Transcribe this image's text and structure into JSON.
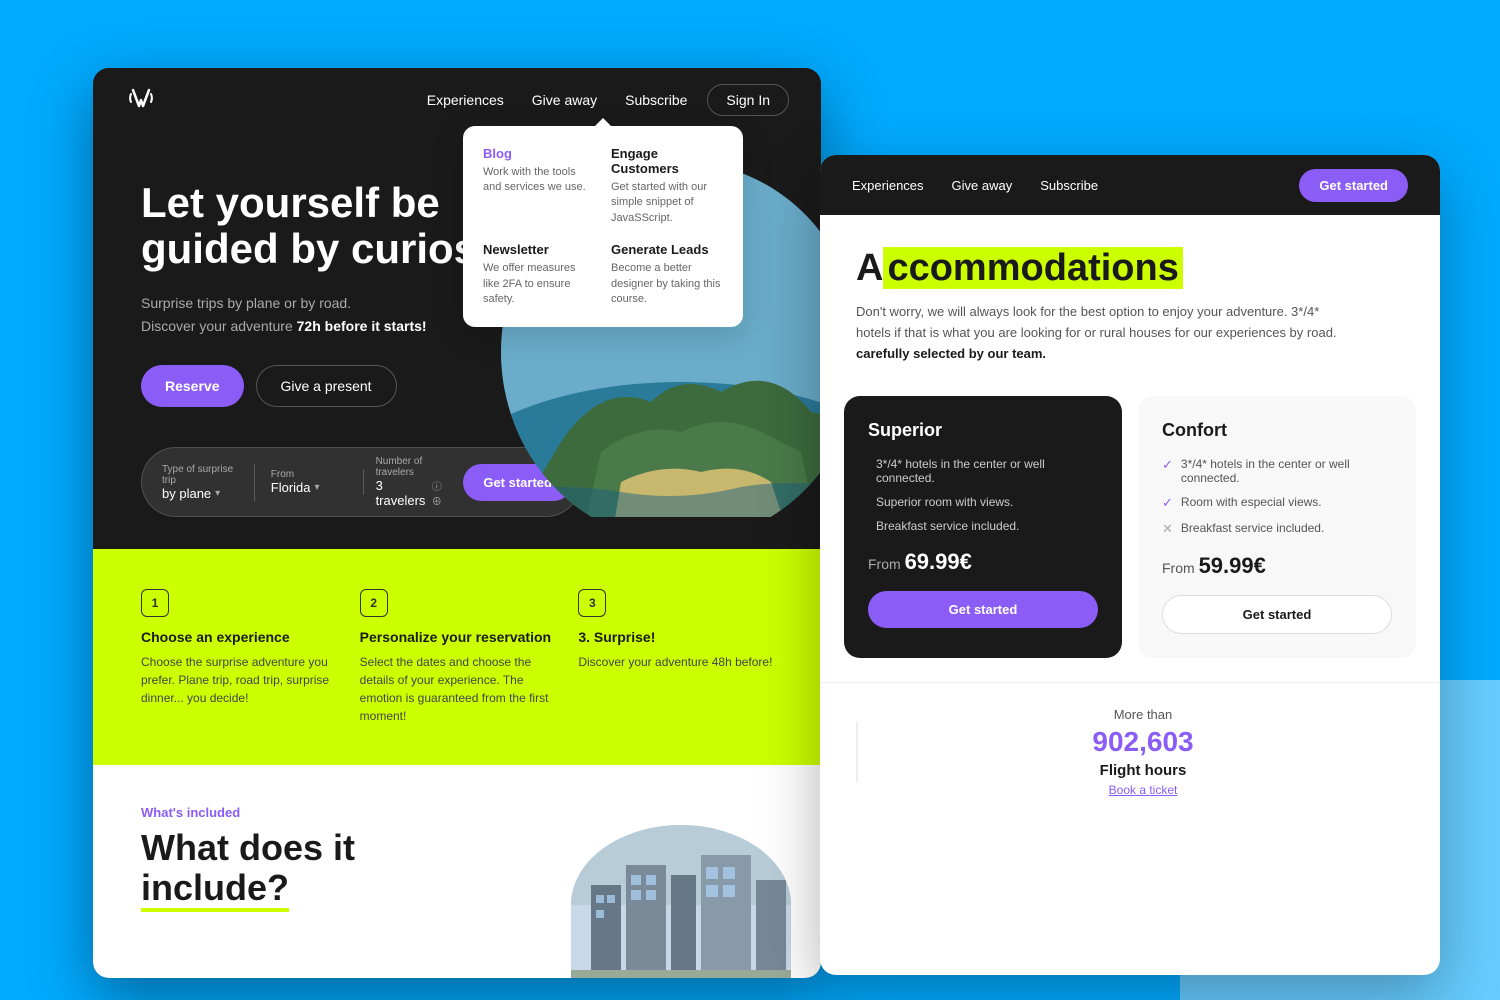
{
  "background": {
    "color": "#00AAFF"
  },
  "window_left": {
    "navbar": {
      "logo_alt": "W logo",
      "links": [
        "Experiences",
        "Give away",
        "Subscribe"
      ],
      "cta_label": "Sign In"
    },
    "dropdown": {
      "items": [
        {
          "title": "Blog",
          "title_color": "purple",
          "desc": "Work with the tools and services we use."
        },
        {
          "title": "Engage Customers",
          "title_color": "dark",
          "desc": "Get started with our simple snippet of JavaSScript."
        },
        {
          "title": "Newsletter",
          "title_color": "dark",
          "desc": "We offer measures like 2FA to ensure safety."
        },
        {
          "title": "Generate Leads",
          "title_color": "dark",
          "desc": "Become a better designer by taking this course."
        }
      ]
    },
    "hero": {
      "title": "Let yourself be guided by curiosity",
      "subtitle_line1": "Surprise trips by plane or by road.",
      "subtitle_line2": "Discover your adventure ",
      "subtitle_bold": "72h before it starts!",
      "btn_reserve": "Reserve",
      "btn_give": "Give a present"
    },
    "search_bar": {
      "type_label": "Type of surprise trip",
      "type_value": "by plane",
      "from_label": "From",
      "from_value": "Florida",
      "travelers_label": "Number of travelers",
      "travelers_value": "3 travelers",
      "cta_label": "Get started"
    },
    "steps": [
      {
        "number": "1",
        "title": "Choose an experience",
        "desc": "Choose the surprise adventure you prefer. Plane trip, road trip, surprise dinner... you decide!"
      },
      {
        "number": "2",
        "title": "Personalize your reservation",
        "desc": "Select the dates and choose the details of your experience. The emotion is guaranteed from the first moment!"
      },
      {
        "number": "3",
        "title": "3. Surprise!",
        "desc": "Discover your adventure 48h before!"
      }
    ],
    "whats_included": {
      "label": "What's included",
      "title_line1": "What does it",
      "title_line2": "include?"
    }
  },
  "window_right": {
    "navbar": {
      "links": [
        "Experiences",
        "Give away",
        "Subscribe"
      ],
      "cta_label": "Get started"
    },
    "accommodations": {
      "title_prefix": "A",
      "title_highlight": "ccommodations",
      "desc": "Don't worry, we will always look for the best option to enjoy your adventure. 3*/4* hotels if that is what you are looking for or rural houses for our experiences by road.",
      "desc_bold": "carefully selected by our team."
    },
    "cards": [
      {
        "type": "superior",
        "title": "Superior",
        "features": [
          "3*/4* hotels in the center or well connected.",
          "Superior room with views.",
          "Breakfast service included."
        ],
        "feature_checks": [
          false,
          false,
          false
        ],
        "from_label": "From",
        "price": "69.99€",
        "cta_label": "Get started"
      },
      {
        "type": "confort",
        "title": "Confort",
        "features": [
          "3*/4* hotels in the center or well connected.",
          "Room with especial views.",
          "Breakfast service included."
        ],
        "feature_checks": [
          true,
          true,
          false
        ],
        "from_label": "From",
        "price": "59.99€",
        "cta_label": "Get started"
      }
    ],
    "stats": {
      "label": "More than",
      "number": "902,603",
      "sublabel": "Flight hours",
      "link_label": "Book a ticket"
    }
  }
}
